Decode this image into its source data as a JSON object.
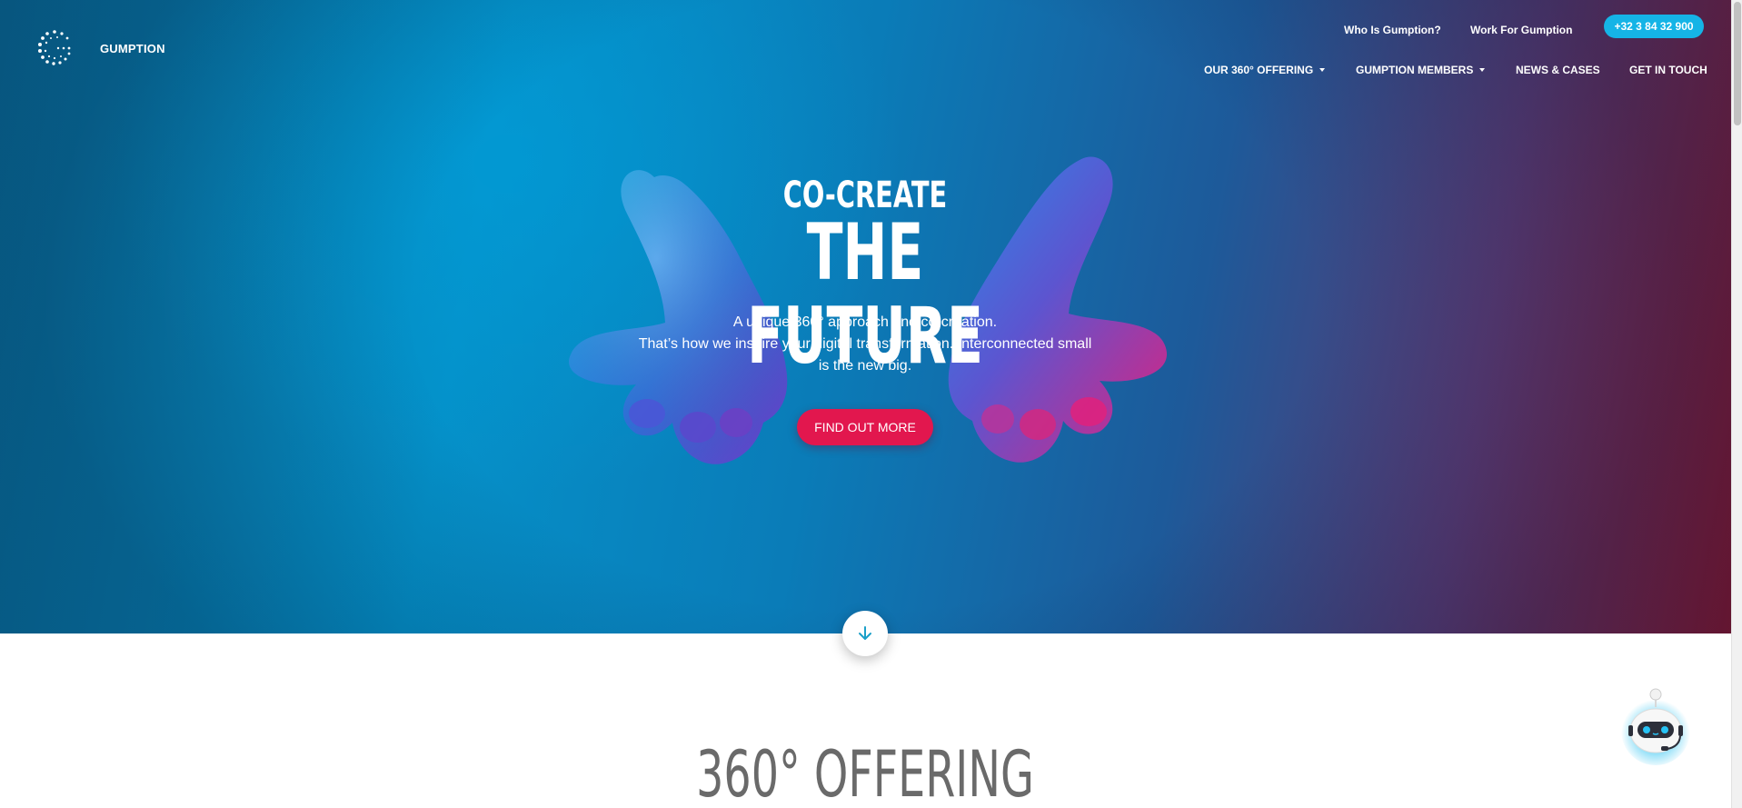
{
  "brand": {
    "name": "GUMPTION",
    "logo_icon": "gumption-dots-logo"
  },
  "top_links": {
    "who": "Who Is Gumption?",
    "work": "Work For Gumption",
    "phone": "+32 3 84 32 900"
  },
  "main_nav": [
    {
      "label": "OUR 360° OFFERING",
      "dropdown": true
    },
    {
      "label": "GUMPTION MEMBERS",
      "dropdown": true
    },
    {
      "label": "NEWS & CASES",
      "dropdown": false
    },
    {
      "label": "GET IN TOUCH",
      "dropdown": false
    }
  ],
  "hero": {
    "kicker": "CO-CREATE",
    "headline": "THE FUTURE",
    "copy_lines": [
      "A unique 360° approach and co-creation.",
      "That’s how we inspire your digital transformation. Interconnected small",
      "is the new big."
    ],
    "cta": "FIND OUT MORE",
    "scroll_icon": "arrow-down-icon"
  },
  "sections": {
    "offering_title": "360° OFFERING"
  },
  "chat_bot": {
    "icon": "chatbot-robot-icon"
  },
  "colors": {
    "accent_cyan": "#15b4e6",
    "cta_pink": "#e2174e",
    "hero_blue": "#0590c8",
    "hero_crimson": "#8a1630",
    "heading_gray": "#6a6a6a"
  }
}
